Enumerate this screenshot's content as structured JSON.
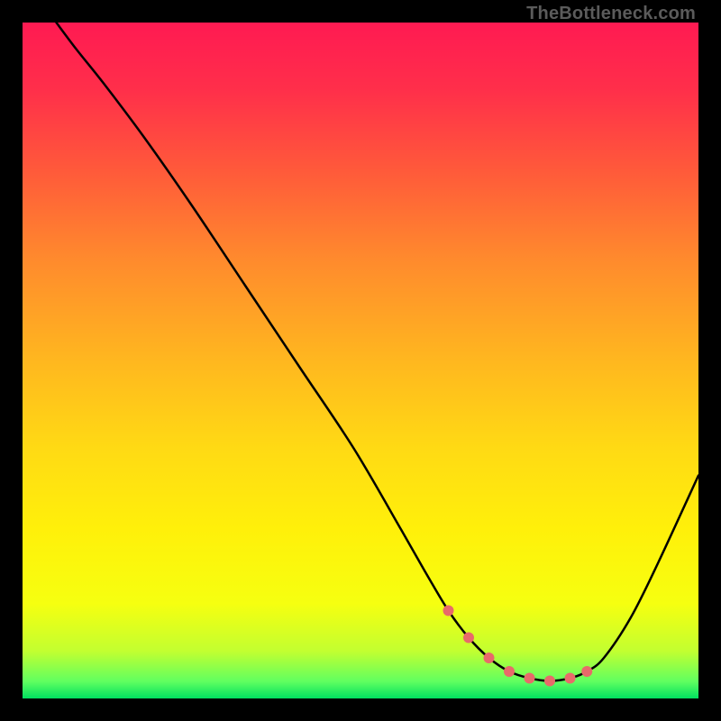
{
  "watermark": "TheBottleneck.com",
  "chart_data": {
    "type": "line",
    "title": "",
    "xlabel": "",
    "ylabel": "",
    "xlim": [
      0,
      100
    ],
    "ylim": [
      0,
      100
    ],
    "gradient_stops": [
      {
        "offset": 0.0,
        "color": "#ff1a52"
      },
      {
        "offset": 0.1,
        "color": "#ff2f4a"
      },
      {
        "offset": 0.22,
        "color": "#ff5a3a"
      },
      {
        "offset": 0.35,
        "color": "#ff8a2d"
      },
      {
        "offset": 0.5,
        "color": "#ffb71f"
      },
      {
        "offset": 0.63,
        "color": "#ffda14"
      },
      {
        "offset": 0.75,
        "color": "#fff00a"
      },
      {
        "offset": 0.86,
        "color": "#f6ff10"
      },
      {
        "offset": 0.93,
        "color": "#c2ff30"
      },
      {
        "offset": 0.975,
        "color": "#60ff60"
      },
      {
        "offset": 1.0,
        "color": "#00e060"
      }
    ],
    "series": [
      {
        "name": "bottleneck-curve",
        "color": "#000000",
        "x": [
          5,
          8,
          12,
          18,
          25,
          33,
          41,
          49,
          56,
          60,
          63,
          66,
          69,
          72,
          75,
          78,
          81,
          83.5,
          86,
          90,
          94,
          100
        ],
        "y": [
          100,
          96,
          91,
          83,
          73,
          61,
          49,
          37,
          25,
          18,
          13,
          9,
          6,
          4,
          3,
          2.6,
          3,
          4,
          6,
          12,
          20,
          33
        ]
      }
    ],
    "markers": {
      "name": "flat-region-dots",
      "color": "#e86a6a",
      "radius_px": 6,
      "x": [
        63,
        66,
        69,
        72,
        75,
        78,
        81,
        83.5
      ],
      "y": [
        13,
        9,
        6,
        4,
        3,
        2.6,
        3,
        4
      ]
    }
  }
}
